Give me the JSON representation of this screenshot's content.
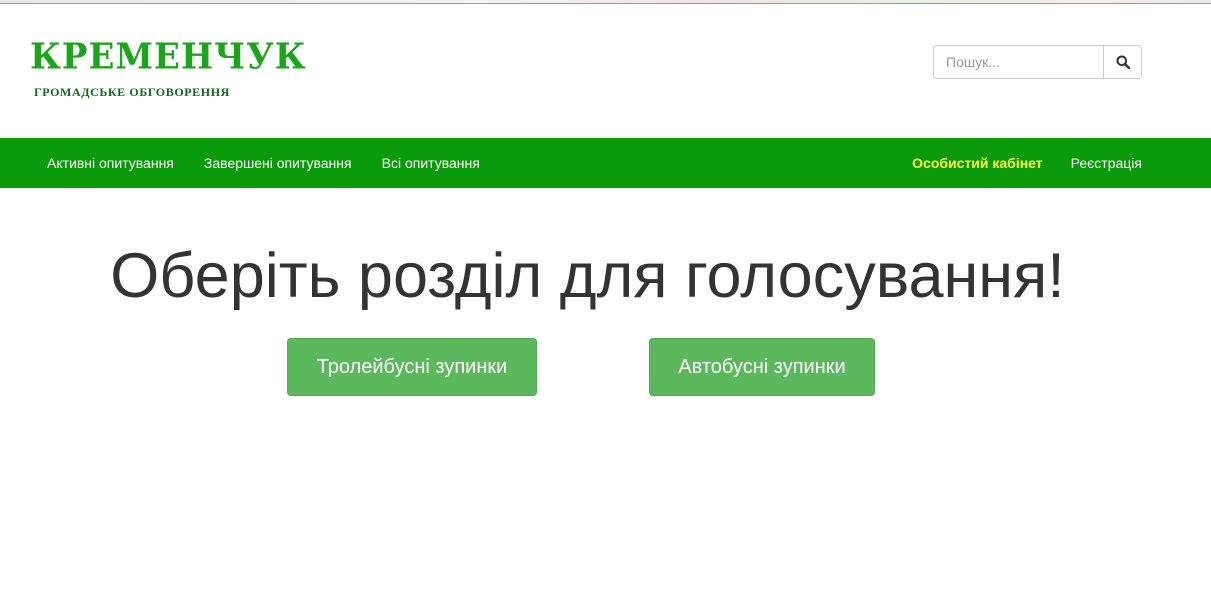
{
  "header": {
    "logo_title": "КРЕМЕНЧУК",
    "logo_subtitle": "ГРОМАДСЬКЕ ОБГОВОРЕННЯ"
  },
  "search": {
    "placeholder": "Пошук...",
    "value": "",
    "icon": "search-icon"
  },
  "nav": {
    "left": [
      {
        "label": "Активні опитування"
      },
      {
        "label": "Завершені опитування"
      },
      {
        "label": "Всі опитування"
      }
    ],
    "right": [
      {
        "label": "Особистий кабінет",
        "highlighted": true
      },
      {
        "label": "Реєстрація"
      }
    ]
  },
  "main": {
    "title": "Оберіть розділ для голосування!",
    "buttons": [
      {
        "label": "Тролейбусні зупинки"
      },
      {
        "label": "Автобусні зупинки"
      }
    ]
  },
  "colors": {
    "navbar": "#0a9a0a",
    "nav_highlight": "#ffff33",
    "logo_green": "#1aa51a",
    "button_green": "#5cb85c"
  }
}
